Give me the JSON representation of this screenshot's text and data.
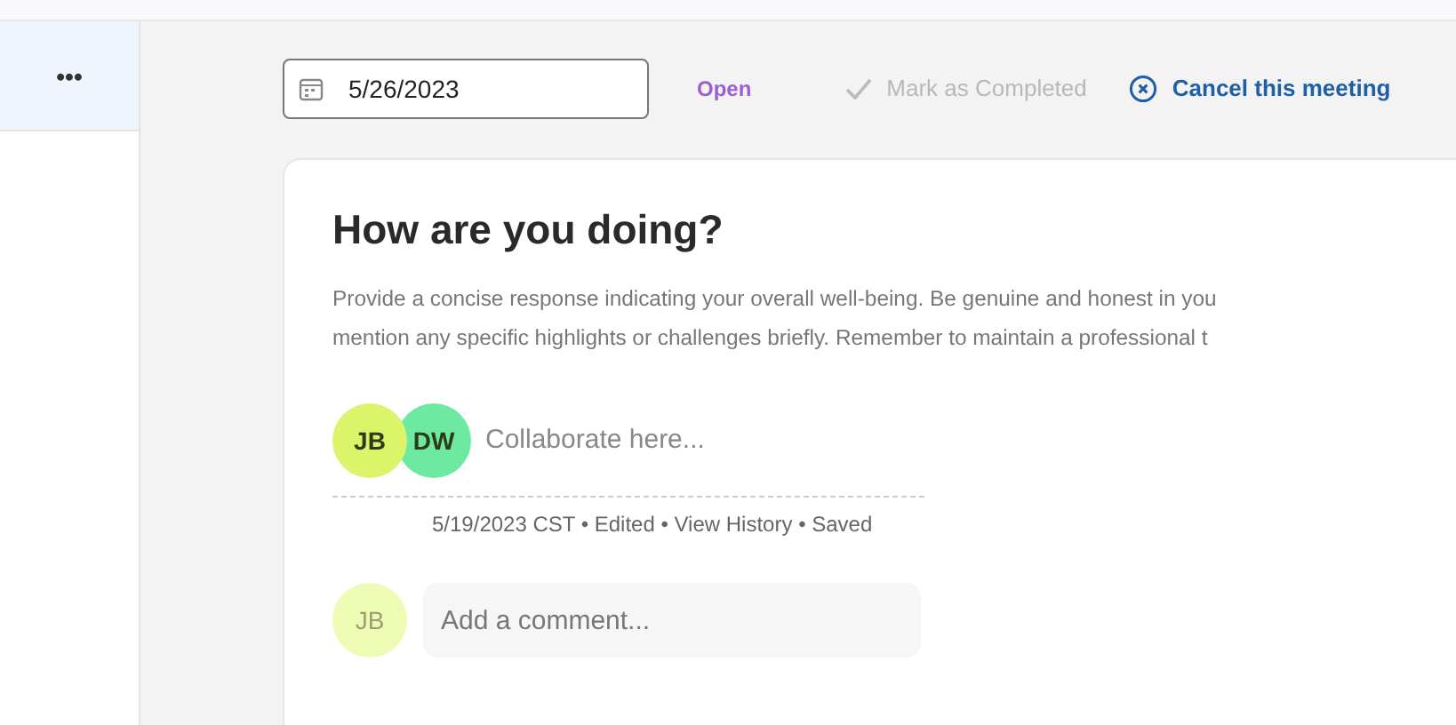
{
  "sidebar": {
    "more_label": "•••"
  },
  "toolbar": {
    "date": "5/26/2023",
    "status": "Open",
    "mark_completed": {
      "label": "Mark as Completed",
      "disabled": true
    },
    "cancel": "Cancel this meeting"
  },
  "card": {
    "title": "How are you doing?",
    "description_lines": [
      "Provide a concise response indicating your overall well-being. Be genuine and honest in you",
      "mention any specific highlights or challenges briefly. Remember to maintain a professional t"
    ],
    "collaborators": [
      {
        "initials": "JB",
        "color": "#dcf46a"
      },
      {
        "initials": "DW",
        "color": "#6ee9a2"
      }
    ],
    "editor_placeholder": "Collaborate here...",
    "meta": "5/19/2023 CST • Edited • View History • Saved",
    "comment": {
      "initials": "JB",
      "color": "#eefbb4",
      "placeholder": "Add a comment..."
    }
  }
}
